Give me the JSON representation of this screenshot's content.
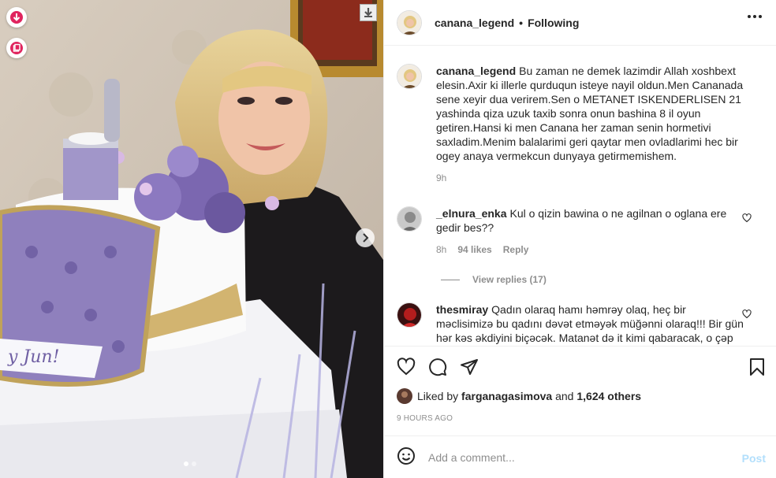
{
  "post": {
    "username": "canana_legend",
    "following": "Following",
    "caption_user": "canana_legend",
    "caption": "Bu zaman ne demek lazimdir Allah xoshbext elesin.Axir ki illerle qurduqun isteye nayil oldun.Men Cananada sene xeyir dua verirem.Sen o METANET ISKENDERLISEN 21 yashinda qiza uzuk taxib sonra onun bashina 8 il oyun getiren.Hansi ki men Canana her zaman senin hormetivi saxladim.Menim balalarimi geri qaytar men ovladlarimi hec bir ogey anaya vermekcun dunyaya getirmemishem.",
    "caption_time": "9h"
  },
  "comments": [
    {
      "user": "_elnura_enka",
      "text": "Kul o qizin bawina o ne agilnan o oglana ere gedir bes??",
      "time": "8h",
      "likes": "94 likes",
      "reply": "Reply",
      "view_replies": "View replies (17)"
    },
    {
      "user": "thesmiray",
      "text": "Qadın olaraq hamı həmrəy olaq, heç bir məclisimizə bu qadını dəvət etməyək müğənni olaraq!!! Bir gün hər kəs əkdiyini biçəcək. Matanət də it kimi qabaracak, o çəp göz"
    }
  ],
  "likes": {
    "prefix": "Liked by",
    "user": "farganagasimova",
    "and": "and",
    "count": "1,624 others"
  },
  "timestamp": "9 HOURS AGO",
  "add_comment": {
    "placeholder": "Add a comment...",
    "post_label": "Post"
  },
  "colors": {
    "accent_red": "#e0245e",
    "post_disabled": "#b2dffc"
  }
}
